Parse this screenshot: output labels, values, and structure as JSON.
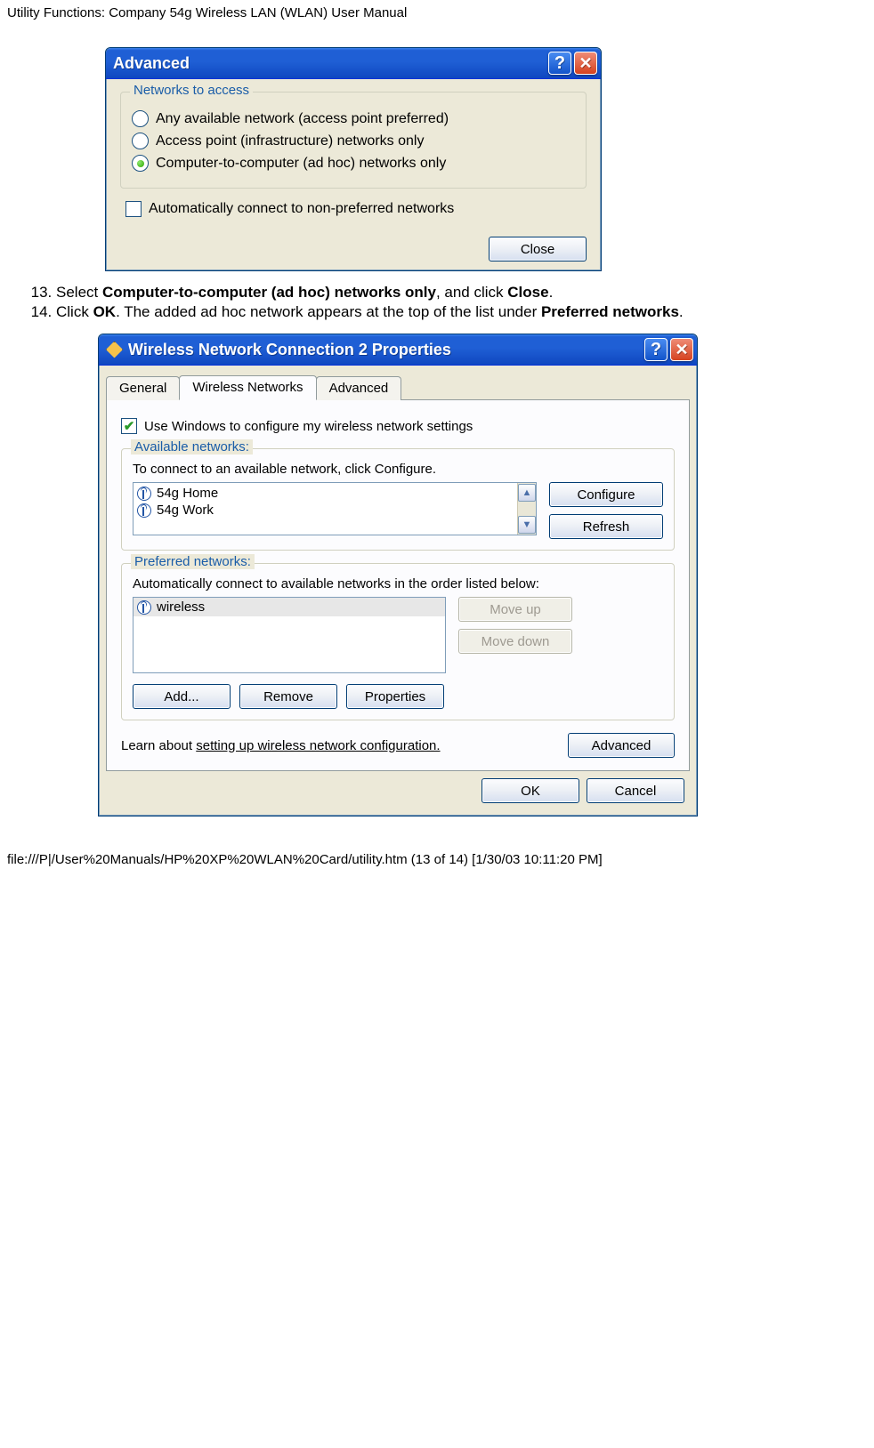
{
  "page": {
    "header": "Utility Functions: Company 54g Wireless LAN (WLAN) User Manual",
    "footer": "file:///P|/User%20Manuals/HP%20XP%20WLAN%20Card/utility.htm (13 of 14) [1/30/03 10:11:20 PM]"
  },
  "steps": {
    "num13": "13.",
    "num14": "14.",
    "s13_a": "Select ",
    "s13_b": "Computer-to-computer (ad hoc) networks only",
    "s13_c": ", and click ",
    "s13_d": "Close",
    "s13_e": ".",
    "s14_a": "Click ",
    "s14_b": "OK",
    "s14_c": ". The added ad hoc network appears at the top of the list under ",
    "s14_d": "Preferred networks",
    "s14_e": "."
  },
  "dlg1": {
    "title": "Advanced",
    "group": "Networks to access",
    "opt1": "Any available network (access point preferred)",
    "opt2": "Access point (infrastructure) networks only",
    "opt3": "Computer-to-computer (ad hoc) networks only",
    "autoconnect": "Automatically connect to non-preferred networks",
    "close": "Close"
  },
  "dlg2": {
    "title": "Wireless Network Connection 2 Properties",
    "tabs": {
      "general": "General",
      "wireless": "Wireless Networks",
      "advanced": "Advanced"
    },
    "usewin": "Use Windows to configure my wireless network settings",
    "avail_group": "Available networks:",
    "avail_hint": "To connect to an available network, click Configure.",
    "avail_items": [
      "54g Home",
      "54g Work"
    ],
    "configure": "Configure",
    "refresh": "Refresh",
    "pref_group": "Preferred networks:",
    "pref_hint": "Automatically connect to available networks in the order listed below:",
    "pref_items": [
      "wireless"
    ],
    "moveup": "Move up",
    "movedown": "Move down",
    "add": "Add...",
    "remove": "Remove",
    "properties": "Properties",
    "learn_a": "Learn about ",
    "learn_link": "setting up wireless network configuration.",
    "advanced_btn": "Advanced",
    "ok": "OK",
    "cancel": "Cancel"
  }
}
